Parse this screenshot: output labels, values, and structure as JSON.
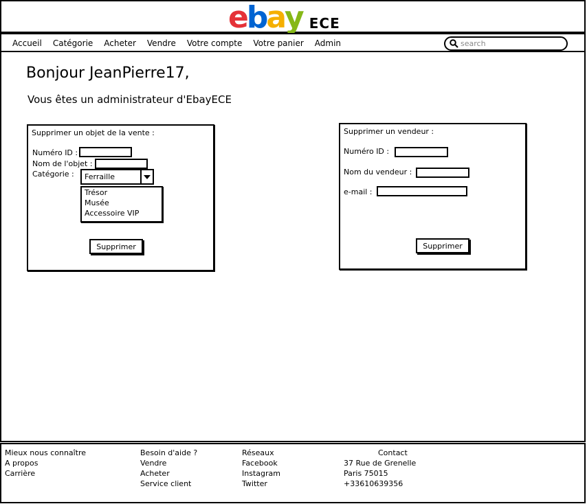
{
  "header": {
    "logo_text": "ebay",
    "logo_letters": [
      "e",
      "b",
      "a",
      "y"
    ],
    "logo_suffix": "ECE",
    "colors": {
      "e": "#e53238",
      "b": "#0064d2",
      "a": "#f5af02",
      "y": "#86b817"
    }
  },
  "nav": {
    "items": [
      "Accueil",
      "Catégorie",
      "Acheter",
      "Vendre",
      "Votre compte",
      "Votre panier",
      "Admin"
    ],
    "search_placeholder": "search"
  },
  "main": {
    "greeting": "Bonjour JeanPierre17,",
    "subtitle": "Vous êtes un administrateur d'EbayECE"
  },
  "delete_object": {
    "title": "Supprimer un objet de la vente :",
    "id_label": "Numéro ID :",
    "id_value": "",
    "name_label": "Nom de l'objet :",
    "name_value": "",
    "category_label": "Catégorie :",
    "category_selected": "Ferraille",
    "category_options": [
      "Trésor",
      "Musée",
      "Accessoire VIP"
    ],
    "submit_label": "Supprimer"
  },
  "delete_seller": {
    "title": "Supprimer un vendeur :",
    "id_label": "Numéro ID :",
    "id_value": "",
    "name_label": "Nom du vendeur :",
    "name_value": "",
    "email_label": "e-mail :",
    "email_value": "",
    "submit_label": "Supprimer"
  },
  "footer": {
    "about": {
      "title": "Mieux nous connaître",
      "links": [
        "A propos",
        "Carrière"
      ]
    },
    "help": {
      "title": "Besoin d'aide ?",
      "links": [
        "Vendre",
        "Acheter",
        "Service client"
      ]
    },
    "social": {
      "title": "Réseaux",
      "links": [
        "Facebook",
        "Instagram",
        "Twitter"
      ]
    },
    "contact": {
      "title": "Contact",
      "lines": [
        "37 Rue de Grenelle",
        "Paris 75015",
        "+33610639356"
      ]
    }
  }
}
